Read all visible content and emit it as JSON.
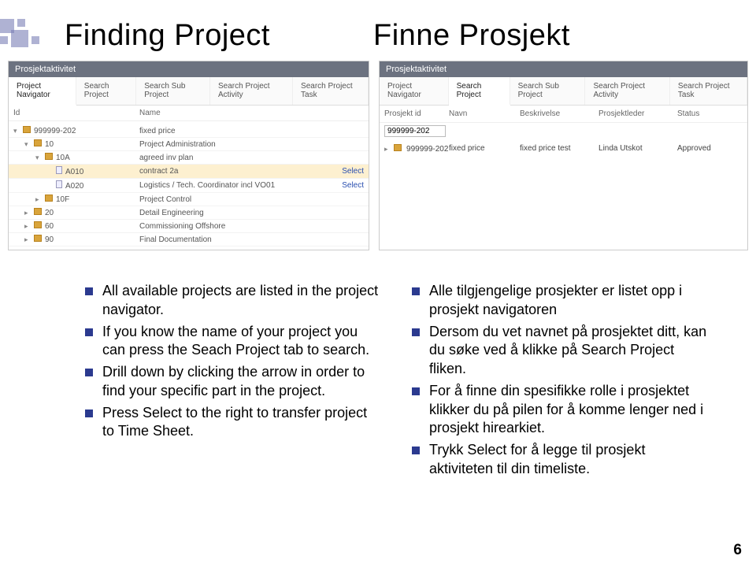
{
  "titles": {
    "left": "Finding Project",
    "right": "Finne Prosjekt"
  },
  "leftPanel": {
    "header": "Prosjektaktivitet",
    "tabs": [
      "Project Navigator",
      "Search Project",
      "Search Sub Project",
      "Search Project Activity",
      "Search Project Task"
    ],
    "activeTab": 0,
    "columns": {
      "id": "Id",
      "name": "Name"
    },
    "rows": [
      {
        "indent": 0,
        "arrow": "▾",
        "icon": "folder",
        "id": "999999-202",
        "name": "fixed price",
        "select": false,
        "hl": false
      },
      {
        "indent": 1,
        "arrow": "▾",
        "icon": "folder",
        "id": "10",
        "name": "Project Administration",
        "select": false,
        "hl": false
      },
      {
        "indent": 2,
        "arrow": "▾",
        "icon": "folder",
        "id": "10A",
        "name": "agreed inv plan",
        "select": false,
        "hl": false
      },
      {
        "indent": 3,
        "arrow": "",
        "icon": "doc",
        "id": "A010",
        "name": "contract 2a",
        "select": true,
        "hl": true
      },
      {
        "indent": 3,
        "arrow": "",
        "icon": "doc",
        "id": "A020",
        "name": "Logistics / Tech. Coordinator incl VO01",
        "select": true,
        "hl": false
      },
      {
        "indent": 2,
        "arrow": "▸",
        "icon": "folder",
        "id": "10F",
        "name": "Project Control",
        "select": false,
        "hl": false
      },
      {
        "indent": 1,
        "arrow": "▸",
        "icon": "folder",
        "id": "20",
        "name": "Detail Engineering",
        "select": false,
        "hl": false
      },
      {
        "indent": 1,
        "arrow": "▸",
        "icon": "folder",
        "id": "60",
        "name": "Commissioning Offshore",
        "select": false,
        "hl": false
      },
      {
        "indent": 1,
        "arrow": "▸",
        "icon": "folder",
        "id": "90",
        "name": "Final Documentation",
        "select": false,
        "hl": false
      }
    ],
    "selectLabel": "Select"
  },
  "rightPanel": {
    "header": "Prosjektaktivitet",
    "tabs": [
      "Project Navigator",
      "Search Project",
      "Search Sub Project",
      "Search Project Activity",
      "Search Project Task"
    ],
    "activeTab": 1,
    "columns": {
      "c1": "Prosjekt id",
      "c2": "Navn",
      "c3": "Beskrivelse",
      "c4": "Prosjektleder",
      "c5": "Status"
    },
    "searchValue": "999999-202",
    "result": {
      "id": "999999-202",
      "navn": "fixed price",
      "besk": "fixed price test",
      "leder": "Linda Utskot",
      "status": "Approved"
    }
  },
  "bulletsLeft": [
    "All available projects are listed in the project navigator.",
    "If you know the name of your project you can press the Seach Project tab to search.",
    "Drill down by clicking the arrow in order to find your specific part in the project.",
    "Press Select to the right to transfer project to Time Sheet."
  ],
  "bulletsRight": [
    "Alle tilgjengelige prosjekter er listet opp i prosjekt navigatoren",
    "Dersom du vet navnet på prosjektet ditt, kan du søke ved å klikke på Search Project fliken.",
    "For å finne din spesifikke rolle i prosjektet klikker du på pilen for å komme lenger ned i prosjekt hirearkiet.",
    "Trykk Select for å legge til prosjekt aktiviteten til din timeliste."
  ],
  "pageNumber": "6"
}
